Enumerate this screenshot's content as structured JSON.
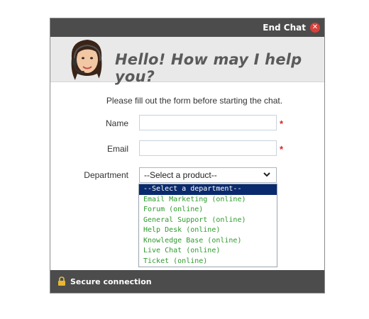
{
  "header": {
    "end_chat_label": "End Chat",
    "close_icon": "close-icon",
    "close_color": "#d9403a"
  },
  "banner": {
    "greeting": "Hello! How may I help you?"
  },
  "form": {
    "intro": "Please fill out the form before starting the chat.",
    "name_label": "Name",
    "name_value": "",
    "email_label": "Email",
    "email_value": "",
    "required_marker": "*",
    "department_label": "Department",
    "department_selected": "--Select a product--",
    "department_options": [
      "--Select a department--",
      "Email Marketing (online)",
      "Forum (online)",
      "General Support (online)",
      "Help Desk (online)",
      "Knowledge Base (online)",
      "Live Chat (online)",
      "Ticket (online)"
    ]
  },
  "footer": {
    "secure_label": "Secure connection",
    "lock_icon": "lock-icon"
  },
  "colors": {
    "bar": "#4c4c4c",
    "highlight": "#0a2a6e",
    "option_text": "#2e9a2e",
    "required": "#e02020"
  }
}
